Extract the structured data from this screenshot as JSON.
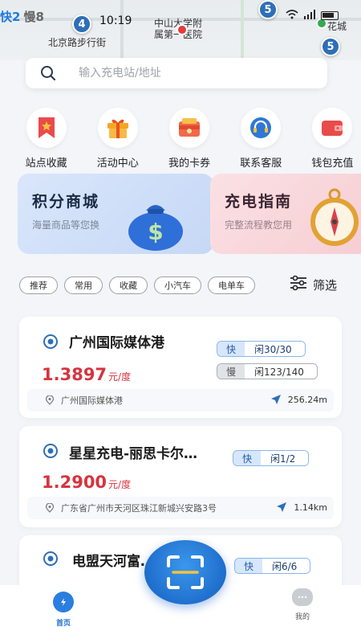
{
  "status": {
    "tab_fast": "快2",
    "tab_slow": "慢8",
    "time": "10:19"
  },
  "map": {
    "labels": [
      "北京路步行街",
      "中山大学附",
      "属第一医院",
      "花城"
    ],
    "clusters": [
      "4",
      "5",
      "5"
    ]
  },
  "search": {
    "placeholder": "输入充电站/地址"
  },
  "quick_actions": [
    {
      "label": "站点收藏",
      "icon": "bookmark-icon"
    },
    {
      "label": "活动中心",
      "icon": "gift-icon"
    },
    {
      "label": "我的卡券",
      "icon": "coupon-wallet-icon"
    },
    {
      "label": "联系客服",
      "icon": "headset-icon"
    },
    {
      "label": "钱包充值",
      "icon": "wallet-icon"
    }
  ],
  "banners": {
    "points": {
      "title": "积分商城",
      "subtitle": "海量商品等您换"
    },
    "guide": {
      "title": "充电指南",
      "subtitle": "完整流程教您用"
    }
  },
  "filters": {
    "chips": [
      "推荐",
      "常用",
      "收藏",
      "小汽车",
      "电单车"
    ],
    "button_label": "筛选"
  },
  "stations": [
    {
      "name": "广州国际媒体港",
      "price": "1.3897",
      "unit": "元/度",
      "fast_key": "快",
      "fast_value": "闲30/30",
      "slow_key": "慢",
      "slow_value": "闲123/140",
      "address": "广州国际媒体港",
      "distance": "256.24m"
    },
    {
      "name": "星星充电-丽思卡尔…",
      "price": "1.2900",
      "unit": "元/度",
      "fast_key": "快",
      "fast_value": "闲1/2",
      "address": "广东省广州市天河区珠江新城兴安路3号",
      "distance": "1.14km"
    },
    {
      "name": "电盟天河富…",
      "fast_key": "快",
      "fast_value": "闲6/6"
    }
  ],
  "bottom_nav": {
    "home": "首页",
    "mine": "我的"
  },
  "colors": {
    "accent": "#1e7be0",
    "price": "#d6343e"
  }
}
